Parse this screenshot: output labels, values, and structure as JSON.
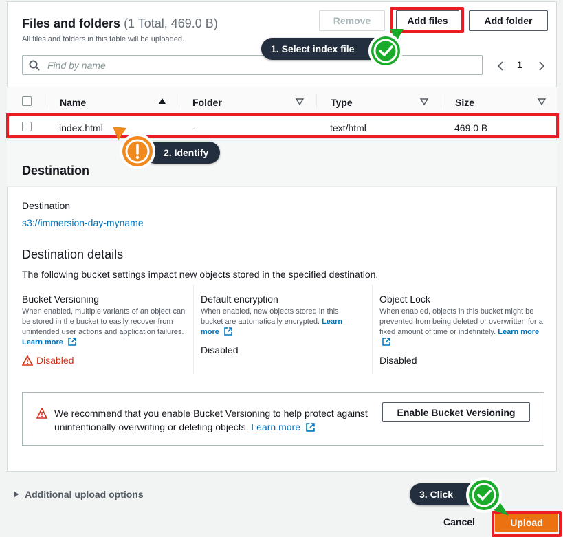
{
  "files": {
    "title": "Files and folders",
    "count": "(1 Total, 469.0 B)",
    "description": "All files and folders in this table will be uploaded.",
    "buttons": {
      "remove": "Remove",
      "add_files": "Add files",
      "add_folder": "Add folder"
    },
    "search_placeholder": "Find by name",
    "page": "1",
    "columns": [
      "Name",
      "Folder",
      "Type",
      "Size"
    ],
    "rows": [
      {
        "name": "index.html",
        "folder": "-",
        "type": "text/html",
        "size": "469.0 B"
      }
    ]
  },
  "destination": {
    "section_title": "Destination",
    "label": "Destination",
    "value": "s3://immersion-day-myname",
    "details_title": "Destination details",
    "details_desc": "The following bucket settings impact new objects stored in the specified destination.",
    "learn_more": "Learn more",
    "versioning": {
      "title": "Bucket Versioning",
      "desc": "When enabled, multiple variants of an object can be stored in the bucket to easily recover from unintended user actions and application failures.",
      "status": "Disabled"
    },
    "encryption": {
      "title": "Default encryption",
      "desc": "When enabled, new objects stored in this bucket are automatically encrypted.",
      "status": "Disabled"
    },
    "object_lock": {
      "title": "Object Lock",
      "desc": "When enabled, objects in this bucket might be prevented from being deleted or overwritten for a fixed amount of time or indefinitely.",
      "status": "Disabled"
    },
    "alert": {
      "text": "We recommend that you enable Bucket Versioning to help protect against unintentionally overwriting or deleting objects.",
      "learn_more": "Learn more",
      "button": "Enable Bucket Versioning"
    }
  },
  "footer": {
    "additional_options": "Additional upload options",
    "cancel": "Cancel",
    "upload": "Upload"
  },
  "callouts": {
    "step1": "1. Select index file",
    "step2": "2. Identify",
    "step3": "3. Click"
  },
  "colors": {
    "highlight_red": "#ec1c24",
    "upload_orange": "#ec7211",
    "link_blue": "#0073bb",
    "check_green": "#1aab2b",
    "warn_orange": "#f0891e",
    "callout_dark": "#232f3e",
    "error_red": "#d13212"
  },
  "icons": [
    "search-icon",
    "chevron-left-icon",
    "chevron-right-icon",
    "sort-up-icon",
    "sort-down-icon",
    "external-link-icon",
    "warning-icon",
    "check-badge-icon",
    "exclamation-badge-icon",
    "caret-right-icon"
  ]
}
